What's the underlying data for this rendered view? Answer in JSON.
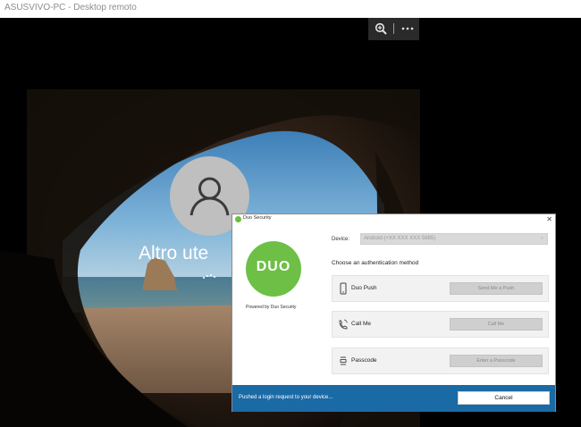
{
  "window": {
    "title": "ASUSVIVO-PC - Desktop remoto"
  },
  "toolbar": {
    "zoom_icon": "zoom-in-icon",
    "more_icon": "more-options-icon"
  },
  "lockscreen": {
    "username": "Altro ute"
  },
  "duo_dialog": {
    "title": "Duo Security",
    "logo_text": "DUO",
    "powered_by": "Powered by Duo Security",
    "device_label": "Device:",
    "device_value": "Android (+XX XXX XXX 5885)",
    "choose_method": "Choose an authentication method",
    "methods": [
      {
        "label": "Duo Push",
        "button": "Send Me a Push",
        "icon": "phone-icon"
      },
      {
        "label": "Call Me",
        "button": "Call Me",
        "icon": "call-icon"
      },
      {
        "label": "Passcode",
        "button": "Enter a Passcode",
        "icon": "passcode-icon"
      }
    ],
    "status": "Pushed a login request to your device...",
    "cancel": "Cancel"
  },
  "colors": {
    "duo_green": "#6dc045",
    "footer_blue": "#1a6aa6"
  }
}
